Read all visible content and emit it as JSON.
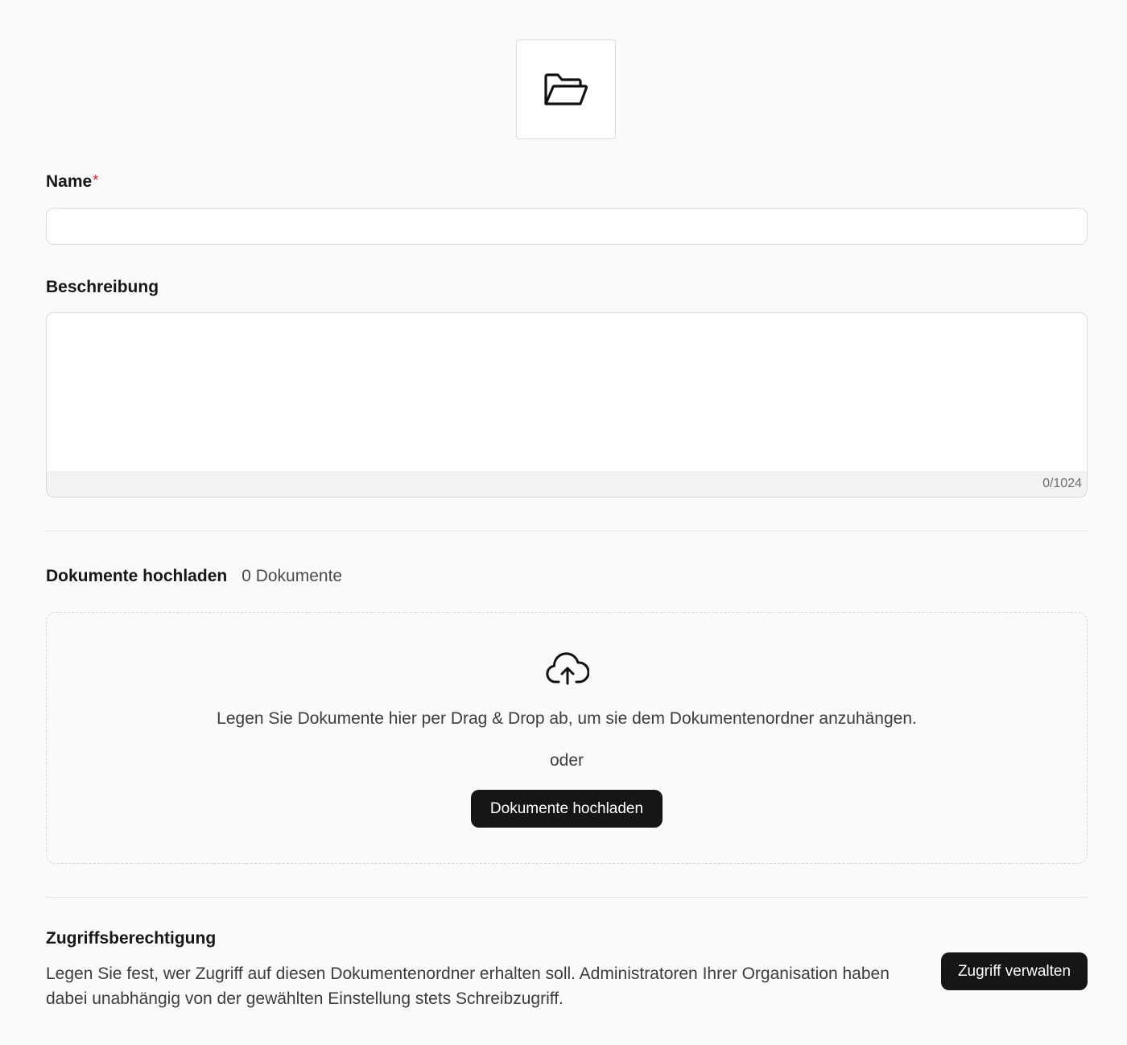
{
  "header": {
    "icon": "folder-open-icon"
  },
  "form": {
    "name_label": "Name",
    "name_required_mark": "*",
    "name_value": "",
    "description_label": "Beschreibung",
    "description_value": "",
    "description_counter": "0/1024"
  },
  "upload": {
    "title": "Dokumente hochladen",
    "count": "0 Dokumente",
    "icon": "cloud-upload-icon",
    "drop_text": "Legen Sie Dokumente hier per Drag & Drop ab, um sie dem Dokumentenordner anzuhängen.",
    "or_text": "oder",
    "button_label": "Dokumente hochladen"
  },
  "access": {
    "title": "Zugriffsberechtigung",
    "description": "Legen Sie fest, wer Zugriff auf diesen Dokumentenordner erhalten soll. Administratoren Ihrer Organisation haben dabei unabhängig von der gewählten Einstellung stets Schreibzugriff.",
    "button_label": "Zugriff verwalten"
  },
  "colors": {
    "background": "#fafafa",
    "button": "#161616",
    "required": "#d8222a"
  }
}
